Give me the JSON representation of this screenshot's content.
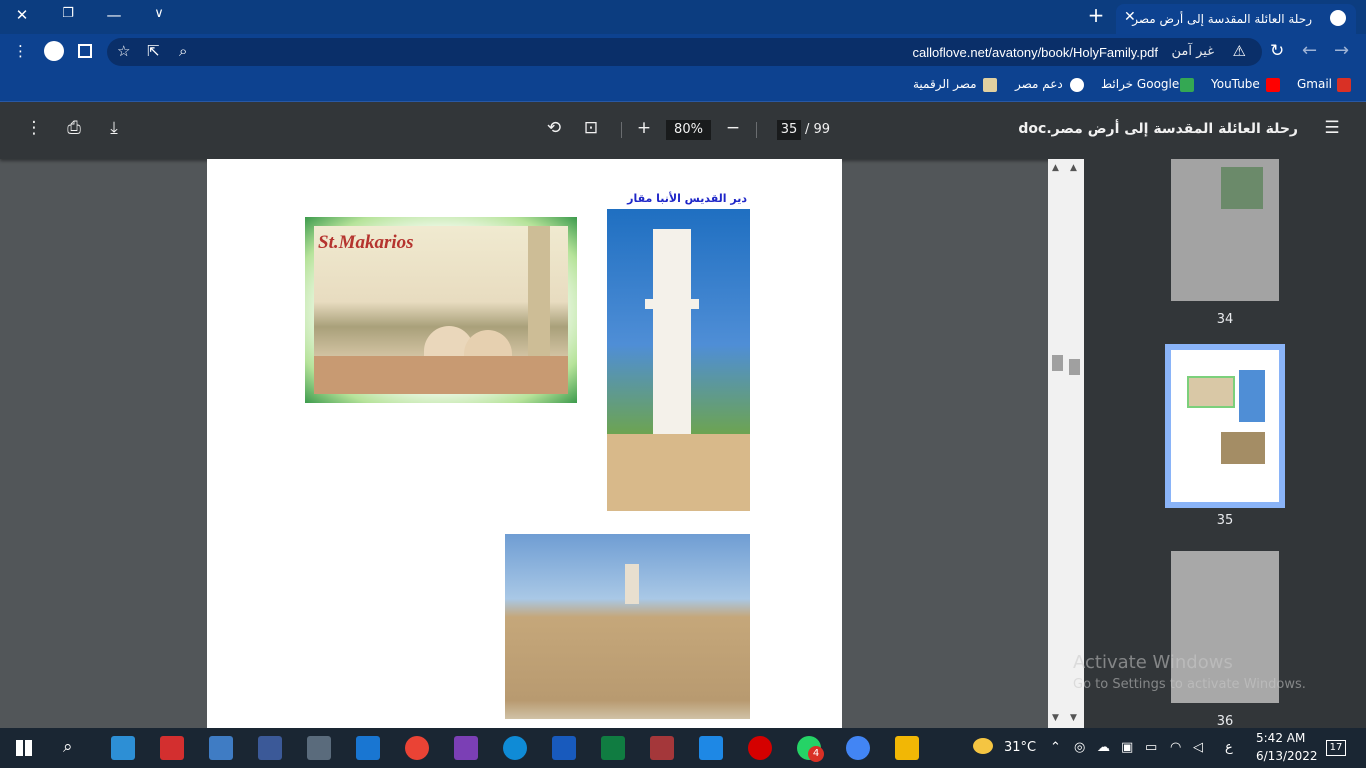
{
  "window": {
    "tab_title": "رحلة العائلة المقدسة إلى أرض مصر",
    "close_tab": "✕",
    "new_tab": "+"
  },
  "address_bar": {
    "url": "calloflove.net/avatony/book/HolyFamily.pdf",
    "security_text": "غير آمن"
  },
  "bookmarks": [
    {
      "label": "Gmail",
      "icon": "gmail-icon",
      "color": "#d93025"
    },
    {
      "label": "YouTube",
      "icon": "youtube-icon",
      "color": "#ff0000"
    },
    {
      "label": "خرائط Google",
      "icon": "maps-icon",
      "color": "#34a853"
    },
    {
      "label": "دعم مصر",
      "icon": "globe-icon",
      "color": "#ffffff"
    },
    {
      "label": "مصر الرقمية",
      "icon": "digital-egypt-icon",
      "color": "#e0d0a0"
    }
  ],
  "pdf_toolbar": {
    "doc_title": "رحلة العائلة المقدسة إلى أرض مصر.doc",
    "current_page": "35",
    "total_pages": "/ 99",
    "zoom": "80%"
  },
  "page": {
    "caption": "دير القديس الأنبا مقار",
    "photo_label": "St.Makarios"
  },
  "thumbnails": [
    {
      "number": "34",
      "selected": false
    },
    {
      "number": "35",
      "selected": true
    },
    {
      "number": "36",
      "selected": false
    }
  ],
  "watermark": {
    "line1": "Activate Windows",
    "line2": "Go to Settings to activate Windows."
  },
  "taskbar": {
    "weather": "31°C",
    "lang": "ع",
    "time": "5:42 AM",
    "date": "6/13/2022",
    "notifications": "17",
    "whatsapp_badge": "4"
  },
  "colors": {
    "titlebar": "#0c3d80",
    "pdf_toolbar": "#323639",
    "caption": "#1f27c8"
  }
}
